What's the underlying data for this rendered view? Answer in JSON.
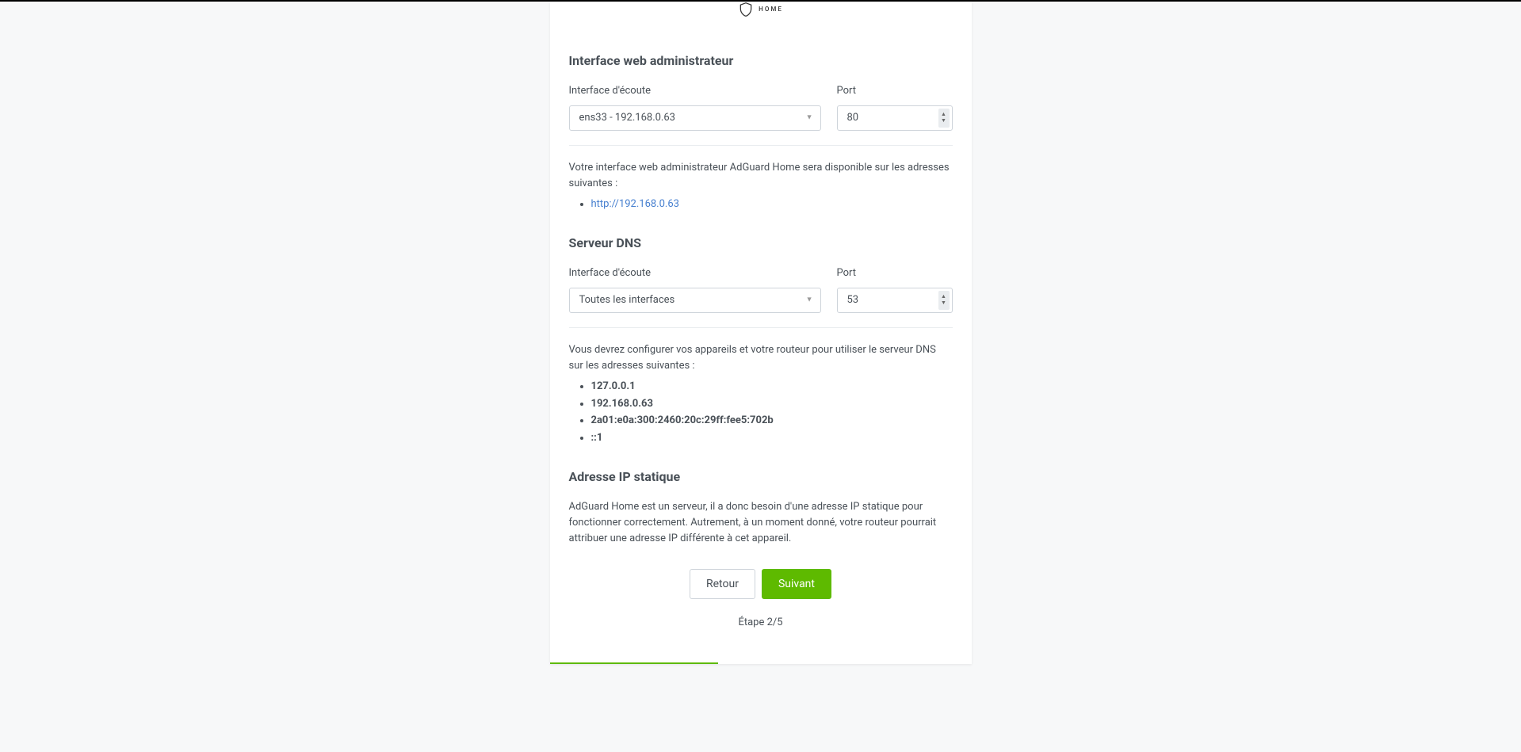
{
  "logo": {
    "home_text": "HOME"
  },
  "web_interface": {
    "title": "Interface web administrateur",
    "listen_label": "Interface d'écoute",
    "listen_value": "ens33 - 192.168.0.63",
    "port_label": "Port",
    "port_value": "80",
    "info_text": "Votre interface web administrateur AdGuard Home sera disponible sur les adresses suivantes :",
    "addresses": [
      {
        "text": "http://192.168.0.63",
        "link": true
      }
    ]
  },
  "dns_server": {
    "title": "Serveur DNS",
    "listen_label": "Interface d'écoute",
    "listen_value": "Toutes les interfaces",
    "port_label": "Port",
    "port_value": "53",
    "info_text": "Vous devrez configurer vos appareils et votre routeur pour utiliser le serveur DNS sur les adresses suivantes :",
    "addresses": [
      {
        "text": "127.0.0.1",
        "bold": true
      },
      {
        "text": "192.168.0.63",
        "bold": true
      },
      {
        "text": "2a01:e0a:300:2460:20c:29ff:fee5:702b",
        "bold": true
      },
      {
        "text": "::1",
        "bold": true
      }
    ]
  },
  "static_ip": {
    "title": "Adresse IP statique",
    "info_text": "AdGuard Home est un serveur, il a donc besoin d'une adresse IP statique pour fonctionner correctement. Autrement, à un moment donné, votre routeur pourrait attribuer une adresse IP différente à cet appareil."
  },
  "buttons": {
    "back": "Retour",
    "next": "Suivant"
  },
  "step": {
    "label": "Étape 2/5",
    "current": 2,
    "total": 5
  }
}
